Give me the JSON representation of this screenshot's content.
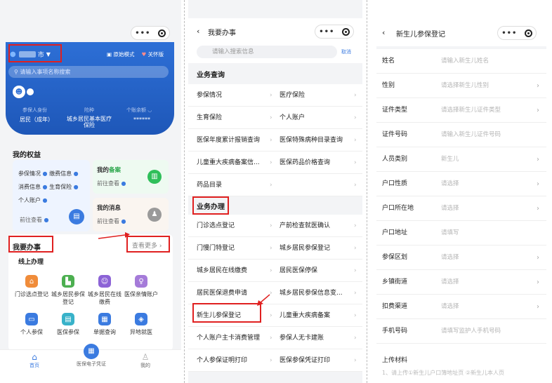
{
  "panel1": {
    "city": "市",
    "mode_label": "原始模式",
    "care_label": "关怀版",
    "search_placeholder": "请输入事项名称搜索",
    "insured_identity_label": "参保人身份",
    "insurance_type_label": "险种",
    "account_balance_label": "个账余额",
    "identity_value": "居民（成年）",
    "insurance_value": "城乡居民基本医疗保险",
    "balance_value": "******",
    "my_rights": "我的权益",
    "rights_links": [
      "参保情况",
      "缴费信息",
      "消费信息",
      "生育保险",
      "个人账户"
    ],
    "go_view": "前往查看",
    "my_record_prefix": "我的",
    "my_record_highlight": "备案",
    "my_messages": "我的消息",
    "go_view2": "前往查看",
    "go_view3": "前往查看",
    "todo_title": "我要办事",
    "view_more": "查看更多",
    "online_title": "线上办理",
    "grid": [
      {
        "label": "门诊选点登记",
        "icon": "home-icon",
        "color": "#f08c3a"
      },
      {
        "label": "城乡居民参保登记",
        "icon": "building-icon",
        "color": "#4caf50"
      },
      {
        "label": "城乡居民在线缴费",
        "icon": "person-icon",
        "color": "#8c63d6"
      },
      {
        "label": "医保亲情账户",
        "icon": "family-icon",
        "color": "#a57bd9"
      },
      {
        "label": "个人参保",
        "icon": "printer-icon",
        "color": "#3b7be0"
      },
      {
        "label": "医保参保",
        "icon": "document-icon",
        "color": "#38b2c9"
      },
      {
        "label": "单据查询",
        "icon": "receipt-icon",
        "color": "#3b7be0"
      },
      {
        "label": "异地就医",
        "icon": "shield-icon",
        "color": "#3b7be0"
      }
    ],
    "tabs": {
      "home": "首页",
      "card": "医保电子凭证",
      "mine": "我的"
    }
  },
  "panel2": {
    "title": "我要办事",
    "search_placeholder": "请输入搜索信息",
    "cancel": "取消",
    "section_query": "业务查询",
    "query_rows": [
      [
        "参保情况",
        "医疗保险"
      ],
      [
        "生育保险",
        "个人账户"
      ],
      [
        "医保年度累计报销查询",
        "医保特殊病种目录查询"
      ],
      [
        "儿童重大疾病备案信...",
        "医保药品价格查询"
      ],
      [
        "药品目录",
        ""
      ]
    ],
    "section_handle": "业务办理",
    "handle_rows": [
      [
        "门诊选点登记",
        "产前检查就医确认"
      ],
      [
        "门慢门特登记",
        "城乡居民参保登记"
      ],
      [
        "城乡居民在线缴费",
        "居民医保停保"
      ],
      [
        "居民医保退费申请",
        "城乡居民参保信息变..."
      ],
      [
        "新生儿参保登记",
        "儿童重大疾病备案"
      ],
      [
        "个人账户主卡消费管理",
        "参保人无卡建账"
      ],
      [
        "个人参保证明打印",
        "医保参保凭证打印"
      ]
    ]
  },
  "panel3": {
    "title": "新生儿参保登记",
    "fields": [
      {
        "label": "姓名",
        "value": "请输入新生儿姓名",
        "arrow": false
      },
      {
        "label": "性别",
        "value": "请选择新生儿性别",
        "arrow": true
      },
      {
        "label": "证件类型",
        "value": "请选择新生儿证件类型",
        "arrow": true
      },
      {
        "label": "证件号码",
        "value": "请输入新生儿证件号码",
        "arrow": false
      },
      {
        "label": "人员类别",
        "value": "新生儿",
        "arrow": true
      },
      {
        "label": "户口性质",
        "value": "请选择",
        "arrow": true
      },
      {
        "label": "户口所在地",
        "value": "请选择",
        "arrow": true
      },
      {
        "label": "户口地址",
        "value": "请填写",
        "arrow": false
      },
      {
        "label": "参保区划",
        "value": "请选择",
        "arrow": true
      },
      {
        "label": "乡镇街道",
        "value": "请选择",
        "arrow": true
      },
      {
        "label": "扣费渠道",
        "value": "请选择",
        "arrow": true
      },
      {
        "label": "手机号码",
        "value": "请填写监护人手机号码",
        "arrow": false
      }
    ],
    "materials_label": "上传材料",
    "materials_note": "1、请上传①新生儿户口簿地址页 ②新生儿本人页"
  },
  "colors": {
    "primary": "#2d6fd6",
    "red_box": "#e02020"
  }
}
